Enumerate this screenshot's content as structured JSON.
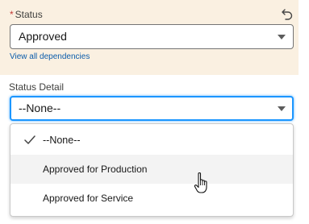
{
  "status_field": {
    "required_mark": "*",
    "label": "Status",
    "value": "Approved",
    "dependencies_link": "View all dependencies",
    "undo_icon": "undo-icon"
  },
  "status_detail_field": {
    "label": "Status Detail",
    "value": "--None--",
    "options": [
      {
        "label": "--None--",
        "selected": true
      },
      {
        "label": "Approved for Production",
        "selected": false
      },
      {
        "label": "Approved for Service",
        "selected": false
      }
    ]
  },
  "colors": {
    "section_bg": "#faf0e1",
    "focus_border": "#1b96ff",
    "link": "#0b5cab",
    "required": "#c23934",
    "hover_option": "#f3f3f3"
  },
  "icons": [
    "undo-icon",
    "chevron-down-icon",
    "check-icon",
    "hand-cursor-icon"
  ]
}
